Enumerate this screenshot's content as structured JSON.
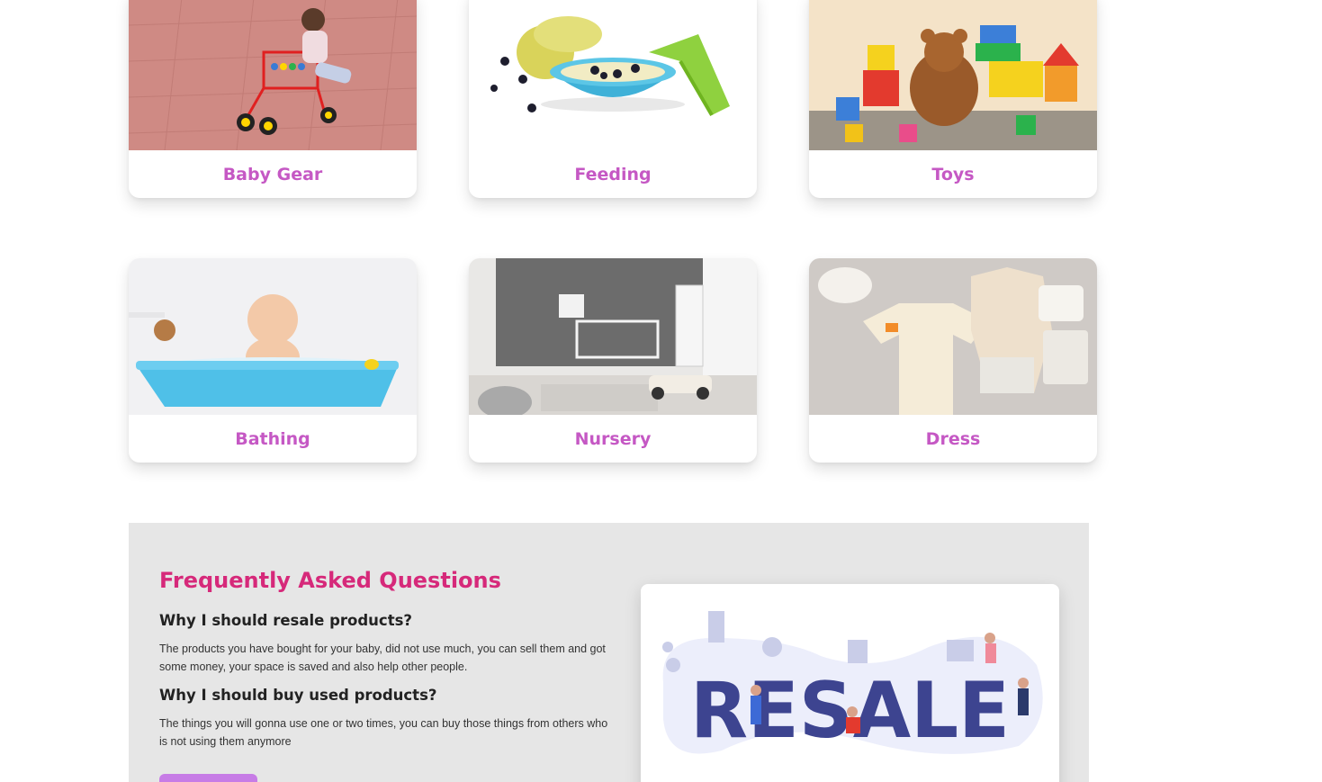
{
  "categories": [
    {
      "label": "Baby Gear",
      "image": "baby-walker-photo"
    },
    {
      "label": "Feeding",
      "image": "feeding-bowl-photo"
    },
    {
      "label": "Toys",
      "image": "toys-photo"
    },
    {
      "label": "Bathing",
      "image": "baby-bathtub-photo"
    },
    {
      "label": "Nursery",
      "image": "nursery-room-photo"
    },
    {
      "label": "Dress",
      "image": "baby-clothes-photo"
    }
  ],
  "faq": {
    "title": "Frequently Asked Questions",
    "items": [
      {
        "question": "Why I should resale products?",
        "answer": "The products you have bought for your baby, did not use much, you can sell them and got some money, your space is saved and also help other people."
      },
      {
        "question": "Why I should buy used products?",
        "answer": "The things you will gonna use one or two times, you can buy those things from others who is not using them anymore"
      }
    ],
    "illustration_text": "RESALE"
  },
  "colors": {
    "category_label": "#c558c4",
    "faq_title": "#d6297a",
    "faq_background": "#e6e6e6",
    "button": "#c77ce6",
    "resale_text": "#3d4490"
  }
}
